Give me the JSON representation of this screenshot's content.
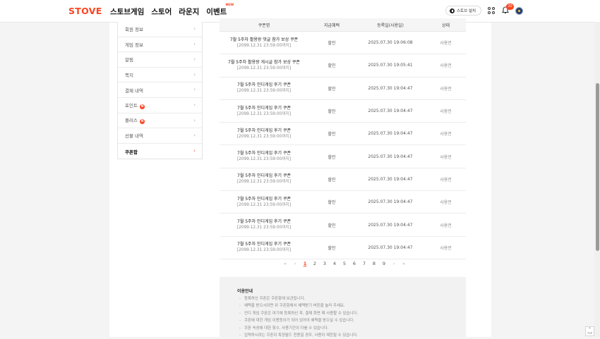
{
  "header": {
    "logo": "STOVE",
    "nav": [
      "스토브게임",
      "스토어",
      "라운지",
      "이벤트"
    ],
    "nav_new_badge": "NEW",
    "install_label": "스토브 설치",
    "notification_count": "20"
  },
  "sidebar": {
    "items": [
      {
        "label": "회원 정보",
        "badge": ""
      },
      {
        "label": "게임 정보",
        "badge": ""
      },
      {
        "label": "알림",
        "badge": ""
      },
      {
        "label": "쪽지",
        "badge": ""
      },
      {
        "label": "결제 내역",
        "badge": ""
      },
      {
        "label": "포인트",
        "badge": "N"
      },
      {
        "label": "플러스",
        "badge": "N"
      },
      {
        "label": "선물 내역",
        "badge": ""
      },
      {
        "label": "쿠폰함",
        "badge": ""
      }
    ],
    "active_index": 8
  },
  "table": {
    "headers": [
      "쿠폰명",
      "지급혜택",
      "등록일(사용일)",
      "상태"
    ],
    "rows": [
      {
        "name": "7월 5주차 활용왕 댓글 참가 보상 쿠폰",
        "period": "[2099.12.31 23:59:00까지]",
        "benefit": "할인",
        "date": "2025.07.30 19:06:08",
        "status": "사용전"
      },
      {
        "name": "7월 5주차 활용왕 게시글 참가 보상 쿠폰",
        "period": "[2099.12.31 23:59:00까지]",
        "benefit": "할인",
        "date": "2025.07.30 19:05:41",
        "status": "사용전"
      },
      {
        "name": "7월 5주차 인디게임 후기 쿠폰",
        "period": "[2099.12.31 23:59:00까지]",
        "benefit": "할인",
        "date": "2025.07.30 19:04:47",
        "status": "사용전"
      },
      {
        "name": "7월 5주차 인디게임 후기 쿠폰",
        "period": "[2099.12.31 23:59:00까지]",
        "benefit": "할인",
        "date": "2025.07.30 19:04:47",
        "status": "사용전"
      },
      {
        "name": "7월 5주차 인디게임 후기 쿠폰",
        "period": "[2099.12.31 23:59:00까지]",
        "benefit": "할인",
        "date": "2025.07.30 19:04:47",
        "status": "사용전"
      },
      {
        "name": "7월 5주차 인디게임 후기 쿠폰",
        "period": "[2099.12.31 23:59:00까지]",
        "benefit": "할인",
        "date": "2025.07.30 19:04:47",
        "status": "사용전"
      },
      {
        "name": "7월 5주차 인디게임 후기 쿠폰",
        "period": "[2099.12.31 23:59:00까지]",
        "benefit": "할인",
        "date": "2025.07.30 19:04:47",
        "status": "사용전"
      },
      {
        "name": "7월 5주차 인디게임 후기 쿠폰",
        "period": "[2099.12.31 23:59:00까지]",
        "benefit": "할인",
        "date": "2025.07.30 19:04:47",
        "status": "사용전"
      },
      {
        "name": "7월 5주차 인디게임 후기 쿠폰",
        "period": "[2099.12.31 23:59:00까지]",
        "benefit": "할인",
        "date": "2025.07.30 19:04:47",
        "status": "사용전"
      },
      {
        "name": "7월 5주차 인디게임 후기 쿠폰",
        "period": "[2099.12.31 23:59:00까지]",
        "benefit": "할인",
        "date": "2025.07.30 19:04:47",
        "status": "사용전"
      }
    ]
  },
  "pagination": {
    "first": "«",
    "prev": "‹",
    "pages": [
      "1",
      "2",
      "3",
      "4",
      "5",
      "6",
      "7",
      "8",
      "9"
    ],
    "current": "1",
    "next": "›",
    "last": "»"
  },
  "notice": {
    "title": "이용안내",
    "items": [
      "등록하신 쿠폰은 쿠폰함에 보관됩니다.",
      "혜택을 받으시려면 위 쿠폰함에서 혜택받기 버튼을 눌러 주세요.",
      "인디 게임 쿠폰은 여기에 등록하신 후, 결제 화면 때 사용할 수 있습니다.",
      "쿠폰에 대한 게임 이용등이가 되어 있어야 혜택을 받으실 수 있습니다.",
      "쿠폰 속성에 대한 횟수, 사용기간이 다를 수 있습니다.",
      "입력하시려는 쿠폰이 특정월드 전용일 경우, 사용이 제한될 수 있습니다."
    ]
  },
  "top_button_label": "TOP",
  "colors": {
    "accent": "#fc4420"
  },
  "icons": [
    "download-icon",
    "apps-grid-icon",
    "bell-icon",
    "avatar-icon",
    "chevron-right-icon",
    "arrow-up-icon"
  ]
}
